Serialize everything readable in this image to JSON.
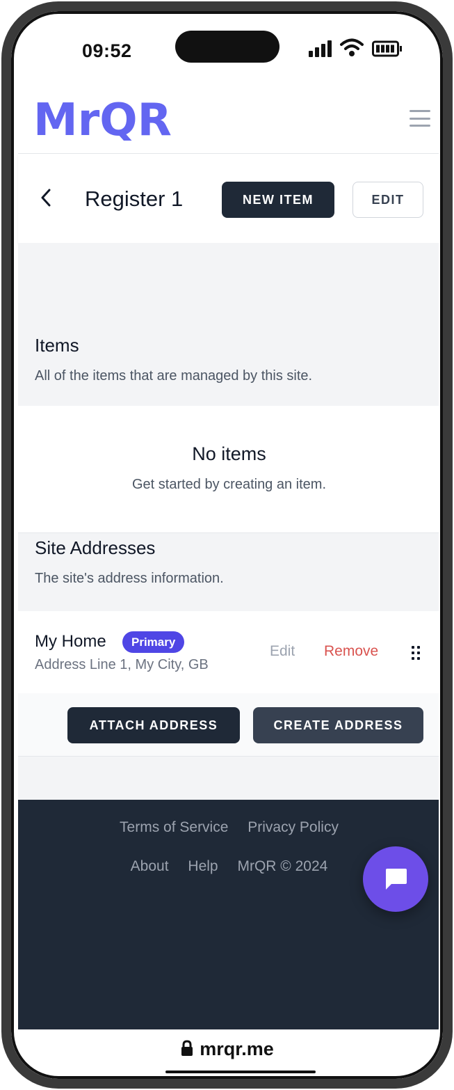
{
  "status_bar": {
    "time": "09:52"
  },
  "header": {
    "logo_text": "MrQR"
  },
  "page": {
    "title": "Register 1",
    "new_item_label": "NEW ITEM",
    "edit_label": "EDIT"
  },
  "items_section": {
    "title": "Items",
    "description": "All of the items that are managed by this site.",
    "empty_title": "No items",
    "empty_subtitle": "Get started by creating an item."
  },
  "addresses_section": {
    "title": "Site Addresses",
    "description": "The site's address information.",
    "addresses": [
      {
        "name": "My Home",
        "badge": "Primary",
        "line": "Address Line 1, My City, GB",
        "edit_label": "Edit",
        "remove_label": "Remove"
      }
    ],
    "attach_label": "ATTACH ADDRESS",
    "create_label": "CREATE ADDRESS"
  },
  "footer": {
    "terms": "Terms of Service",
    "privacy": "Privacy Policy",
    "about": "About",
    "help": "Help",
    "copyright": "MrQR © 2024"
  },
  "browser": {
    "url": "mrqr.me"
  },
  "colors": {
    "brand_logo": "#6366f1",
    "dark_button": "#1f2937",
    "badge": "#4f46e5",
    "remove_text": "#d9534f",
    "footer_bg": "#1f2937",
    "chat_button": "#6d4ee8"
  },
  "icons": [
    "back-chevron-icon",
    "hamburger-menu-icon",
    "drag-handle-icon",
    "chat-bubble-icon",
    "lock-icon",
    "signal-icon",
    "wifi-icon",
    "battery-icon"
  ]
}
